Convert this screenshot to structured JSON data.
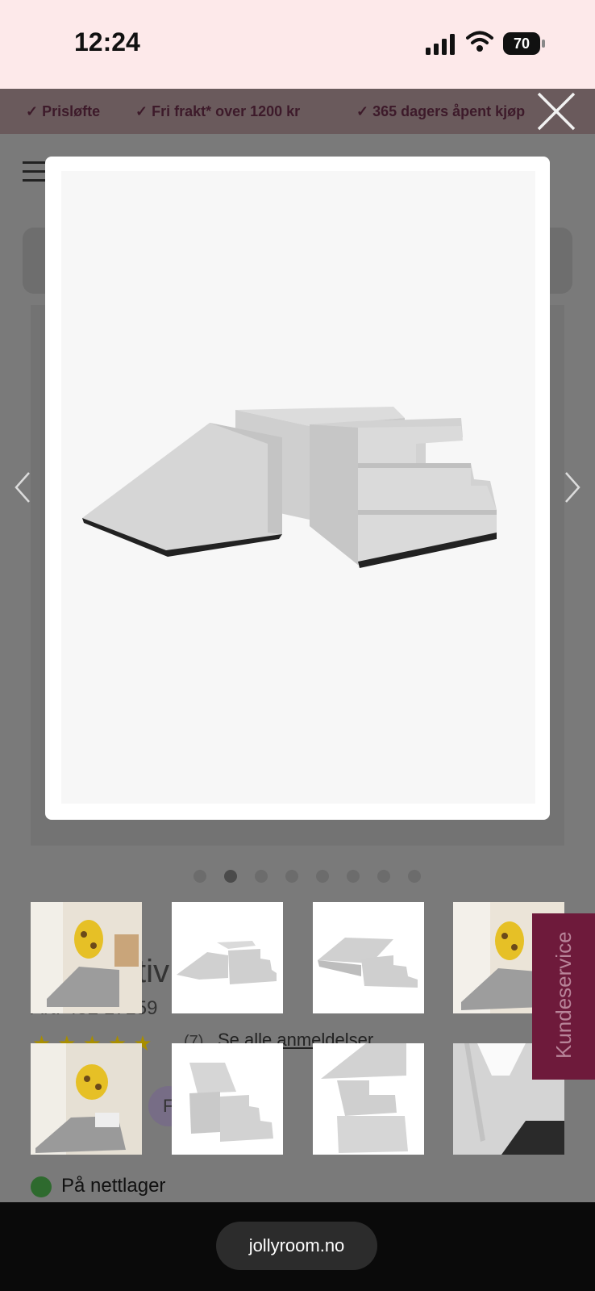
{
  "status_bar": {
    "time": "12:24",
    "battery": "70"
  },
  "promo": {
    "items": [
      "✓ Prisløfte",
      "✓ Fri frakt* over 1200 kr",
      "✓ 365 dagers åpent kjøp"
    ]
  },
  "product": {
    "title_partial": "tiv        okl        n",
    "article_partial": "Art. 452 17159",
    "rating_stars": "★★★★★",
    "review_count": "(7)",
    "reviews_link": "Se alle anmeldelser",
    "pill_text": "F"
  },
  "gallery": {
    "dot_count": 8,
    "active_dot": 1,
    "thumb_icons": [
      "playroom-photo",
      "foam-set-photo",
      "foam-set-photo",
      "playroom-photo",
      "playroom-photo",
      "foam-stairs-photo",
      "foam-tower-photo",
      "foam-closeup-photo"
    ]
  },
  "side_tab": {
    "label": "Kundeservice"
  },
  "stock": {
    "label": "På nettlager"
  },
  "browser": {
    "url": "jollyroom.no"
  },
  "colors": {
    "status_bg": "#fde9ea",
    "brand": "#6e1a3b",
    "in_stock": "#2e6a2e"
  }
}
